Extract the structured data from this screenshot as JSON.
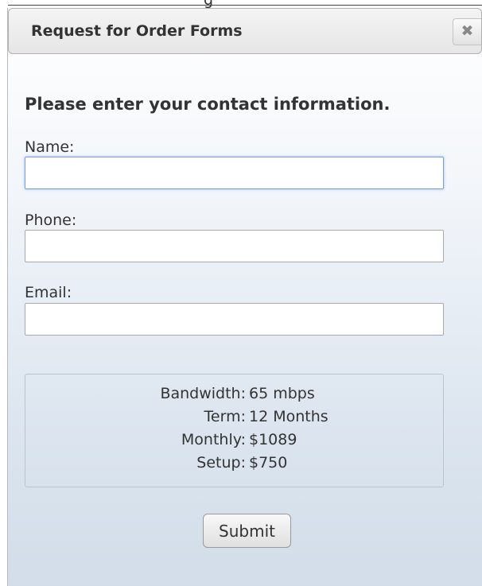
{
  "page_top_text": "g",
  "dialog": {
    "title": "Request for Order Forms",
    "close_icon": "close-icon",
    "close_glyph": "✖"
  },
  "form": {
    "heading": "Please enter your contact information.",
    "name_label": "Name:",
    "name_value": "",
    "phone_label": "Phone:",
    "phone_value": "",
    "email_label": "Email:",
    "email_value": ""
  },
  "summary": {
    "rows": [
      {
        "label": "Bandwidth:",
        "value": "65 mbps"
      },
      {
        "label": "Term:",
        "value": "12 Months"
      },
      {
        "label": "Monthly:",
        "value": "$1089"
      },
      {
        "label": "Setup:",
        "value": "$750"
      }
    ]
  },
  "submit_label": "Submit",
  "colors": {
    "focus_border": "#7c9fd3",
    "panel_gradient_top": "#ffffff",
    "panel_gradient_bottom": "#d2dde9"
  }
}
